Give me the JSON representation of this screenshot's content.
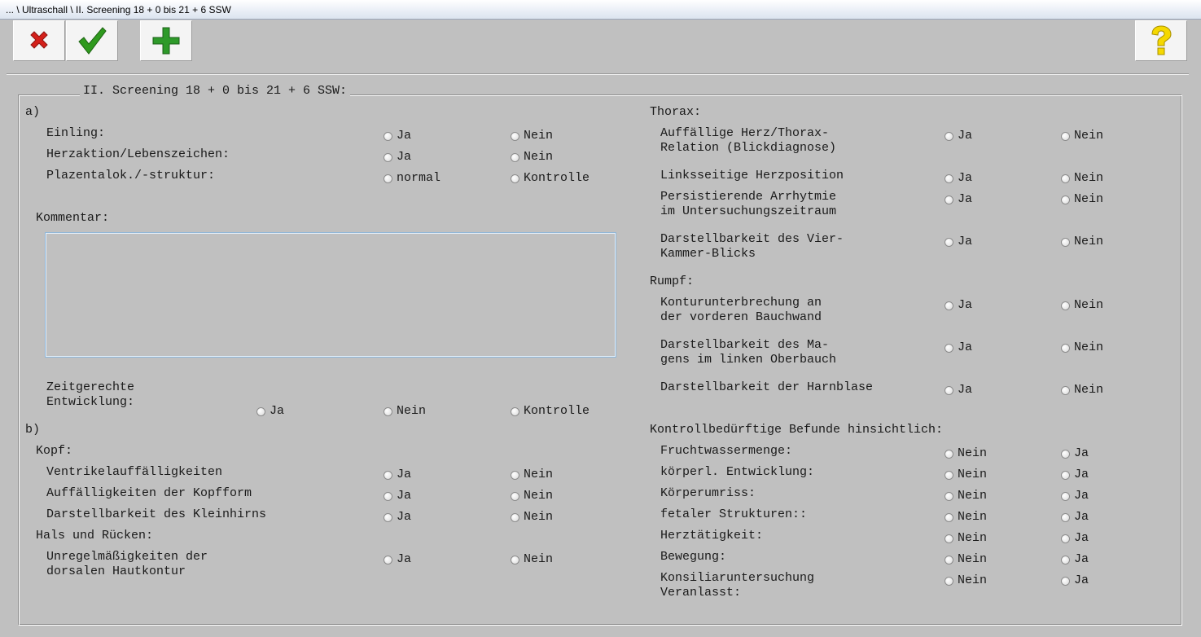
{
  "window": {
    "title": "... \\ Ultraschall \\ II. Screening 18 + 0 bis 21 + 6 SSW"
  },
  "toolbar": {
    "cancel": {
      "icon": "close-icon",
      "color": "#d4201a"
    },
    "ok": {
      "icon": "checkmark-icon",
      "color": "#2f9a1e"
    },
    "add": {
      "icon": "plus-icon",
      "color": "#2e9a2a"
    },
    "help": {
      "icon": "question-icon",
      "color": "#f5d800"
    }
  },
  "group": {
    "title": "II. Screening 18 + 0 bis 21 + 6 SSW:"
  },
  "section_a": {
    "label": "a)",
    "rows": [
      {
        "label": "Einling:",
        "options": [
          "Ja",
          "Nein"
        ]
      },
      {
        "label": "Herzaktion/Lebenszeichen:",
        "options": [
          "Ja",
          "Nein"
        ]
      },
      {
        "label": "Plazentalok./-struktur:",
        "options": [
          "normal",
          "Kontrolle"
        ]
      }
    ],
    "kommentar": {
      "label": "Kommentar:",
      "value": ""
    },
    "entwicklung": {
      "label_line1": "Zeitgerechte",
      "label_line2": "Entwicklung:",
      "options": [
        "Ja",
        "Nein",
        "Kontrolle"
      ]
    }
  },
  "section_b": {
    "label": "b)",
    "kopf": {
      "heading": "Kopf:",
      "rows": [
        {
          "label": "Ventrikelauffälligkeiten",
          "options": [
            "Ja",
            "Nein"
          ]
        },
        {
          "label": "Auffälligkeiten der Kopfform",
          "options": [
            "Ja",
            "Nein"
          ]
        },
        {
          "label": "Darstellbarkeit des Kleinhirns",
          "options": [
            "Ja",
            "Nein"
          ]
        }
      ]
    },
    "hals": {
      "heading": "Hals und Rücken:",
      "rows": [
        {
          "label_line1": "Unregelmäßigkeiten der",
          "label_line2": "dorsalen Hautkontur",
          "options": [
            "Ja",
            "Nein"
          ]
        }
      ]
    }
  },
  "thorax": {
    "heading": "Thorax:",
    "rows": [
      {
        "label_line1": "Auffällige Herz/Thorax-",
        "label_line2": "Relation (Blickdiagnose)",
        "options": [
          "Ja",
          "Nein"
        ]
      },
      {
        "label_line1": "Linksseitige Herzposition",
        "label_line2": "",
        "options": [
          "Ja",
          "Nein"
        ]
      },
      {
        "label_line1": "Persistierende Arrhytmie",
        "label_line2": "im Untersuchungszeitraum",
        "options": [
          "Ja",
          "Nein"
        ]
      },
      {
        "label_line1": "Darstellbarkeit des Vier-",
        "label_line2": "Kammer-Blicks",
        "options": [
          "Ja",
          "Nein"
        ]
      }
    ]
  },
  "rumpf": {
    "heading": "Rumpf:",
    "rows": [
      {
        "label_line1": "Konturunterbrechung an",
        "label_line2": "der vorderen Bauchwand",
        "options": [
          "Ja",
          "Nein"
        ]
      },
      {
        "label_line1": "Darstellbarkeit des Ma-",
        "label_line2": "gens im linken Oberbauch",
        "options": [
          "Ja",
          "Nein"
        ]
      },
      {
        "label_line1": "Darstellbarkeit der Harnblase",
        "label_line2": "",
        "options": [
          "Ja",
          "Nein"
        ]
      }
    ]
  },
  "kontroll": {
    "heading": "Kontrollbedürftige Befunde hinsichtlich:",
    "rows": [
      {
        "label_line1": "Fruchtwassermenge:",
        "label_line2": "",
        "options": [
          "Nein",
          "Ja"
        ]
      },
      {
        "label_line1": "körperl. Entwicklung:",
        "label_line2": "",
        "options": [
          "Nein",
          "Ja"
        ]
      },
      {
        "label_line1": "Körperumriss:",
        "label_line2": "",
        "options": [
          "Nein",
          "Ja"
        ]
      },
      {
        "label_line1": "fetaler Strukturen::",
        "label_line2": "",
        "options": [
          "Nein",
          "Ja"
        ]
      },
      {
        "label_line1": "Herztätigkeit:",
        "label_line2": "",
        "options": [
          "Nein",
          "Ja"
        ]
      },
      {
        "label_line1": "Bewegung:",
        "label_line2": "",
        "options": [
          "Nein",
          "Ja"
        ]
      },
      {
        "label_line1": "Konsiliaruntersuchung",
        "label_line2": "Veranlasst:",
        "options": [
          "Nein",
          "Ja"
        ]
      }
    ]
  }
}
